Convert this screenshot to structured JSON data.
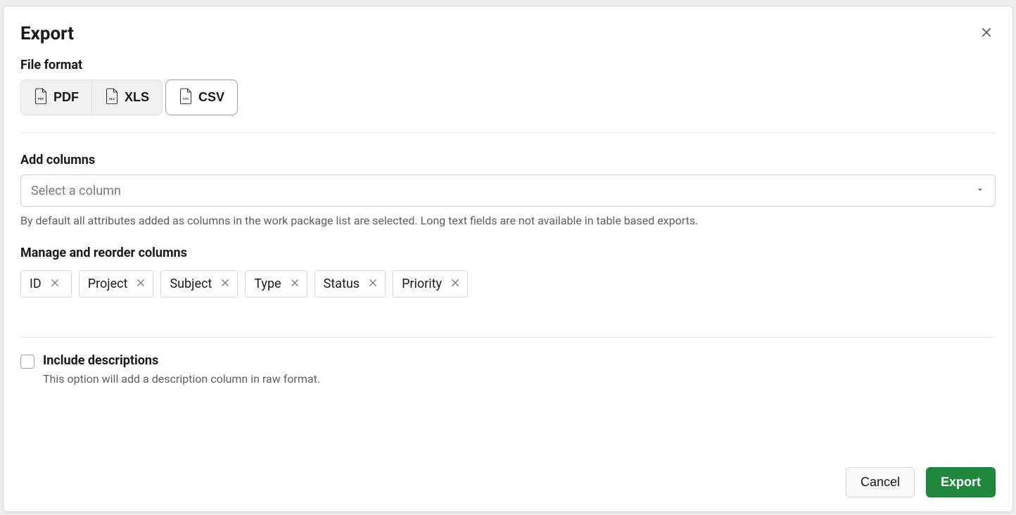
{
  "modal": {
    "title": "Export",
    "sections": {
      "file_format": {
        "label": "File format",
        "options": {
          "pdf": "PDF",
          "xls": "XLS",
          "csv": "CSV"
        }
      },
      "add_columns": {
        "label": "Add columns",
        "placeholder": "Select a column",
        "help": "By default all attributes added as columns in the work package list are selected. Long text fields are not available in table based exports."
      },
      "manage_columns": {
        "label": "Manage and reorder columns",
        "chips": [
          "ID",
          "Project",
          "Subject",
          "Type",
          "Status",
          "Priority"
        ]
      },
      "include_descriptions": {
        "label": "Include descriptions",
        "sub": "This option will add a description column in raw format."
      }
    },
    "buttons": {
      "cancel": "Cancel",
      "export": "Export"
    }
  }
}
